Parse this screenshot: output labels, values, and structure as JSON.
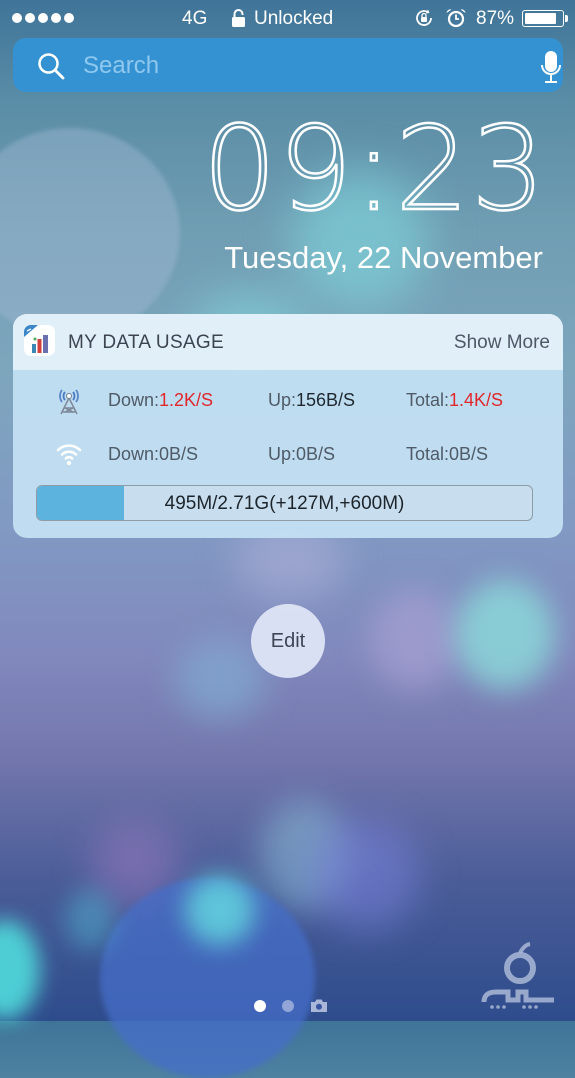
{
  "status_bar": {
    "signal_dots": 5,
    "carrier": "4G",
    "lock_state": "Unlocked",
    "battery_percent_text": "87%",
    "battery_level": 0.87,
    "icons": [
      "signal-dots-icon",
      "padlock-open-icon",
      "rotation-lock-icon",
      "alarm-clock-icon",
      "battery-icon"
    ]
  },
  "search": {
    "placeholder": "Search",
    "value": "",
    "icons": [
      "search-icon",
      "microphone-icon"
    ]
  },
  "clock": {
    "time": "09:23",
    "date": "Tuesday, 22 November"
  },
  "widget": {
    "title": "MY DATA USAGE",
    "show_more": "Show More",
    "app_icon": "bar-chart-app-icon",
    "colors": {
      "highlight": "#e0272c",
      "progress": "#5bb3de"
    },
    "rows": [
      {
        "icon": "cell-tower-icon",
        "down_label": "Down:",
        "down_value": "1.2K/S",
        "up_label": "Up:",
        "up_value": "156B/S",
        "total_label": "Total:",
        "total_value": "1.4K/S"
      },
      {
        "icon": "wifi-icon",
        "down_label": "Down:",
        "down_value": "0B/S",
        "up_label": "Up:",
        "up_value": "0B/S",
        "total_label": "Total:",
        "total_value": "0B/S"
      }
    ],
    "usage": {
      "text": "495M/2.71G(+127M,+600M)",
      "fraction": 0.176
    }
  },
  "edit_label": "Edit",
  "pager": {
    "pages": 2,
    "active_index": 0,
    "trailing_icon": "camera-icon"
  },
  "watermark": "sibche-logo"
}
